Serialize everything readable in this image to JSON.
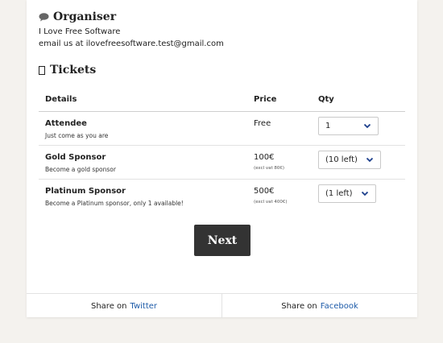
{
  "organiser": {
    "heading": "Organiser",
    "name": "I Love Free Software",
    "email_prefix": "email us at",
    "email": "ilovefreesoftware.test@gmail.com"
  },
  "tickets": {
    "heading": "Tickets",
    "columns": [
      "Details",
      "Price",
      "Qty"
    ],
    "rows": [
      {
        "name": "Attendee",
        "desc": "Just come as you are",
        "price": "Free",
        "vat": "",
        "qty": "1"
      },
      {
        "name": "Gold Sponsor",
        "desc": "Become a gold sponsor",
        "price": "100€",
        "vat": "(excl vat 80€)",
        "qty": "(10 left)"
      },
      {
        "name": "Platinum Sponsor",
        "desc": "Become a Platinum sponsor, only 1 available!",
        "price": "500€",
        "vat": "(excl vat 400€)",
        "qty": "(1 left)"
      }
    ]
  },
  "actions": {
    "next_label": "Next"
  },
  "share": {
    "prefix": "Share on",
    "twitter": "Twitter",
    "facebook": "Facebook"
  },
  "icons": {
    "organiser": "speech-bubble-icon",
    "tickets": "ticket-icon",
    "select": "chevron-down-icon"
  },
  "colors": {
    "background": "#f4f2ee",
    "card": "#ffffff",
    "button": "#333333",
    "link": "#1c5aa8",
    "chevron": "#1c3f8c"
  }
}
